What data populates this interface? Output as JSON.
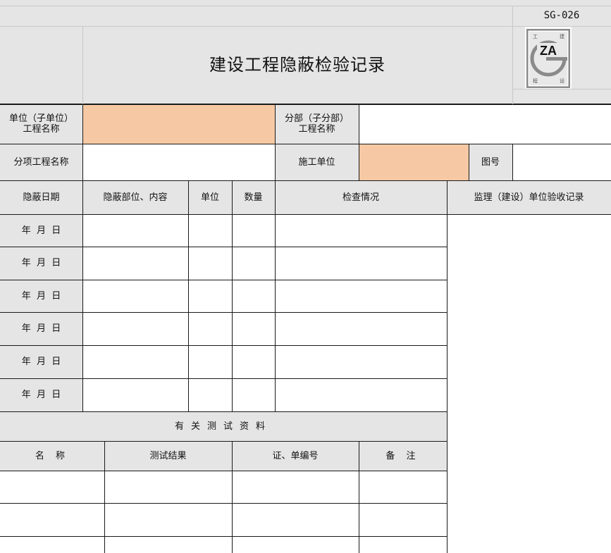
{
  "form": {
    "code": "SG-026",
    "title": "建设工程隐蔽检验记录",
    "logo": {
      "mark": "ZA",
      "corner_tl": "工",
      "corner_tr": "建",
      "corner_bl": "程",
      "corner_br": "设"
    }
  },
  "info": {
    "unit_project_label": "单位（子单位）\n工程名称",
    "unit_project_value": "",
    "sub_project_label": "分部（子分部）\n工程名称",
    "sub_project_value": "",
    "item_project_label": "分项工程名称",
    "item_project_value": "",
    "constructor_label": "施工单位",
    "constructor_value": "",
    "drawing_no_label": "图号",
    "drawing_no_value": ""
  },
  "hidden_table": {
    "headers": [
      "隐蔽日期",
      "隐蔽部位、内容",
      "单位",
      "数量",
      "检查情况",
      "监理（建设）单位验收记录"
    ],
    "rows": [
      {
        "date": "年  月  日"
      },
      {
        "date": "年  月  日"
      },
      {
        "date": "年  月  日"
      },
      {
        "date": "年  月  日"
      },
      {
        "date": "年  月  日"
      },
      {
        "date": "年  月  日"
      }
    ]
  },
  "test_section": {
    "title": "有关测试资料",
    "headers": [
      "名 称",
      "测试结果",
      "证、单编号",
      "备 注"
    ]
  },
  "colors": {
    "header_grey": "#e5e5e5",
    "input_peach": "#f6c9a4"
  }
}
